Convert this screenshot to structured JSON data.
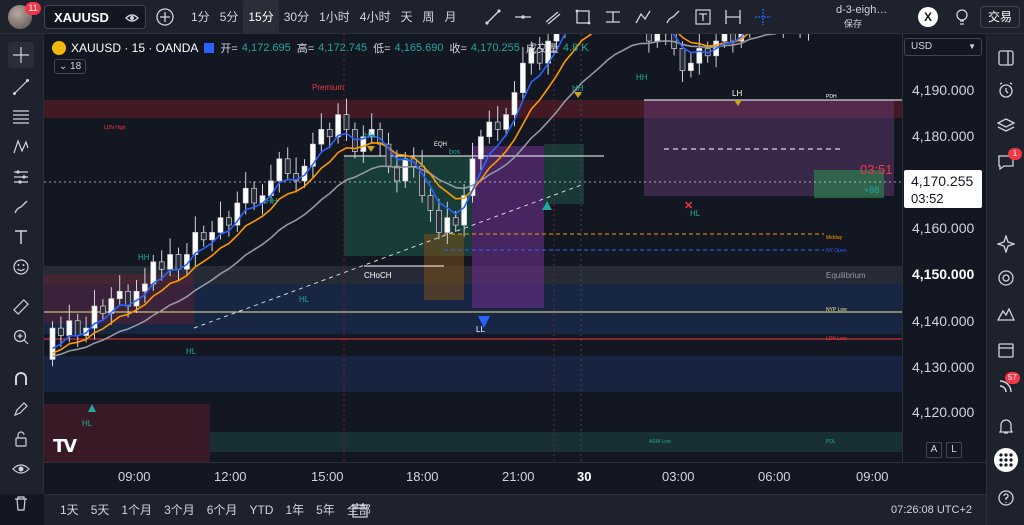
{
  "topbar": {
    "notification_count": "11",
    "symbol": "XAUUSD",
    "intervals": [
      {
        "label": "1分",
        "active": false
      },
      {
        "label": "5分",
        "active": false
      },
      {
        "label": "15分",
        "active": true
      },
      {
        "label": "30分",
        "active": false
      },
      {
        "label": "1小时",
        "active": false
      },
      {
        "label": "4小时",
        "active": false
      },
      {
        "label": "天",
        "active": false
      },
      {
        "label": "周",
        "active": false
      },
      {
        "label": "月",
        "active": false
      }
    ],
    "drawing_tools": [
      "trend-line-icon",
      "horizontal-line-icon",
      "parallel-channel-icon",
      "rectangle-icon",
      "long-position-icon",
      "path-icon",
      "brush-icon",
      "text-icon",
      "measure-icon",
      "crosshair-icon"
    ],
    "layout_name": "d-3-eigh…",
    "layout_status": "保存",
    "close_label": "X",
    "trade_label": "交易"
  },
  "legend": {
    "symbol_line": "XAUUSD · 15 · OANDA",
    "open_label": "开=",
    "open": "4,172.695",
    "high_label": "高=",
    "high": "4,172.745",
    "low_label": "低=",
    "low": "4,165.690",
    "close_label": "收=",
    "close": "4,170.255",
    "volume_label": "成交量",
    "volume": "4.8 K",
    "indicator_count": "18"
  },
  "price_axis": {
    "currency": "USD",
    "labels": [
      {
        "text": "4,190.000",
        "bold": false
      },
      {
        "text": "4,180.000",
        "bold": false
      },
      {
        "text": "4,160.000",
        "bold": false
      },
      {
        "text": "4,150.000",
        "bold": true
      },
      {
        "text": "4,140.000",
        "bold": false
      },
      {
        "text": "4,130.000",
        "bold": false
      },
      {
        "text": "4,120.000",
        "bold": false
      }
    ],
    "last_price": "4,170.255",
    "countdown": "03:52",
    "bar_timer": "03:51",
    "auto_label": "A",
    "log_label": "L"
  },
  "time_axis": {
    "labels": [
      {
        "text": "09:00",
        "bold": false
      },
      {
        "text": "12:00",
        "bold": false
      },
      {
        "text": "15:00",
        "bold": false
      },
      {
        "text": "18:00",
        "bold": false
      },
      {
        "text": "21:00",
        "bold": false
      },
      {
        "text": "30",
        "bold": true
      },
      {
        "text": "03:00",
        "bold": false
      },
      {
        "text": "06:00",
        "bold": false
      },
      {
        "text": "09:00",
        "bold": false
      }
    ]
  },
  "bottombar": {
    "ranges": [
      "1天",
      "5天",
      "1个月",
      "3个月",
      "6个月",
      "YTD",
      "1年",
      "5年",
      "全部"
    ],
    "clock": "07:26:08 UTC+2"
  },
  "annotations": {
    "premium": "Premium",
    "ldn_high": "LDN High",
    "eqh": "EQH",
    "choch": "CHoCH",
    "bos": "bos",
    "hh": "HH",
    "hl": "HL",
    "lh": "LH",
    "ll": "LL",
    "midday": "Midday",
    "ny_open": "NY Open",
    "equilibrium": "Equilibrium",
    "nyp_low": "NYP Low",
    "ldn_low": "LDN Low",
    "asia_low": "ASIA Low",
    "pdl": "PDL",
    "pdh": "PDH",
    "plus88": "+88",
    "tv_logo": "TV"
  },
  "rightbar": {
    "chat_badge": "1",
    "alerts_badge": "57"
  },
  "colors": {
    "up": "#26a69a",
    "down": "#ef5350",
    "bg": "#131722",
    "ema_fast": "#2962ff",
    "ema_mid": "#ff9800",
    "ema_slow": "#9598a1"
  }
}
